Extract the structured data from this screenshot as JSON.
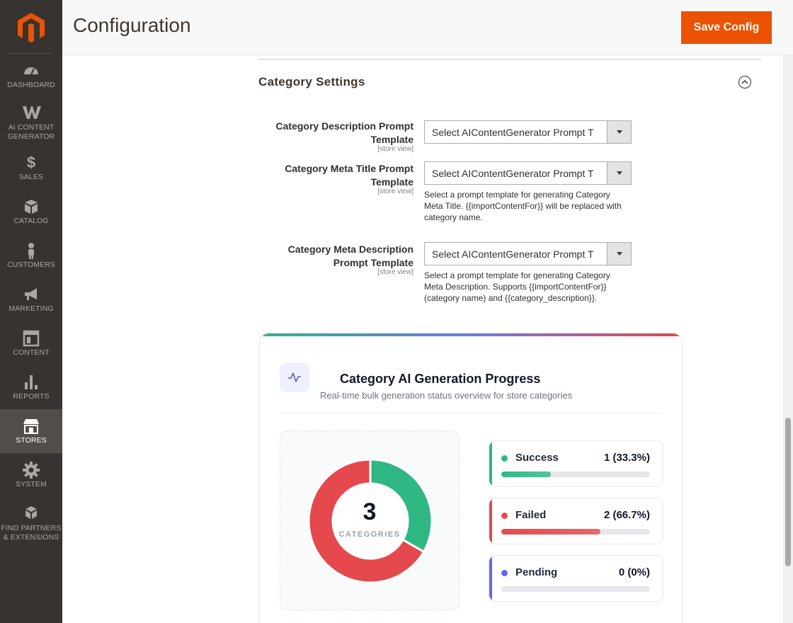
{
  "sidebar": {
    "items": [
      {
        "label": "DASHBOARD",
        "icon": "dashboard-icon"
      },
      {
        "label": "AI CONTENT GENERATOR",
        "icon": "ai-content-generator-icon"
      },
      {
        "label": "SALES",
        "icon": "dollar-icon"
      },
      {
        "label": "CATALOG",
        "icon": "box-icon"
      },
      {
        "label": "CUSTOMERS",
        "icon": "person-icon"
      },
      {
        "label": "MARKETING",
        "icon": "megaphone-icon"
      },
      {
        "label": "CONTENT",
        "icon": "layout-icon"
      },
      {
        "label": "REPORTS",
        "icon": "bar-chart-icon"
      },
      {
        "label": "STORES",
        "icon": "storefront-icon",
        "active": true
      },
      {
        "label": "SYSTEM",
        "icon": "gear-icon"
      },
      {
        "label": "FIND PARTNERS & EXTENSIONS",
        "icon": "boxes-icon"
      }
    ]
  },
  "header": {
    "title": "Configuration",
    "save_label": "Save Config"
  },
  "section": {
    "title": "Category Settings",
    "fields": [
      {
        "label": "Category Description Prompt Template",
        "scope": "[store view]",
        "value": "Select AIContentGenerator Prompt T",
        "note": ""
      },
      {
        "label": "Category Meta Title Prompt Template",
        "scope": "[store view]",
        "value": "Select AIContentGenerator Prompt T",
        "note": "Select a prompt template for generating Category Meta Title. {{importContentFor}} will be replaced with category name."
      },
      {
        "label": "Category Meta Description Prompt Template",
        "scope": "[store view]",
        "value": "Select AIContentGenerator Prompt T",
        "note": "Select a prompt template for generating Category Meta Description. Supports {{importContentFor}} (category name) and {{category_description}}."
      }
    ]
  },
  "progress": {
    "title": "Category AI Generation Progress",
    "subtitle": "Real-time bulk generation status overview for store categories",
    "total": "3",
    "total_caption": "CATEGORIES",
    "stats": [
      {
        "name": "Success",
        "value": "1 (33.3%)",
        "fraction": 0.333,
        "color": "#2fb884"
      },
      {
        "name": "Failed",
        "value": "2 (66.7%)",
        "fraction": 0.667,
        "color": "#e5484d"
      },
      {
        "name": "Pending",
        "value": "0 (0%)",
        "fraction": 0,
        "color": "#6366f1"
      }
    ]
  },
  "colors": {
    "accent": "#eb5202",
    "sidebar_bg": "#373330",
    "success": "#2fb884",
    "failed": "#e5484d",
    "pending": "#6366f1"
  }
}
